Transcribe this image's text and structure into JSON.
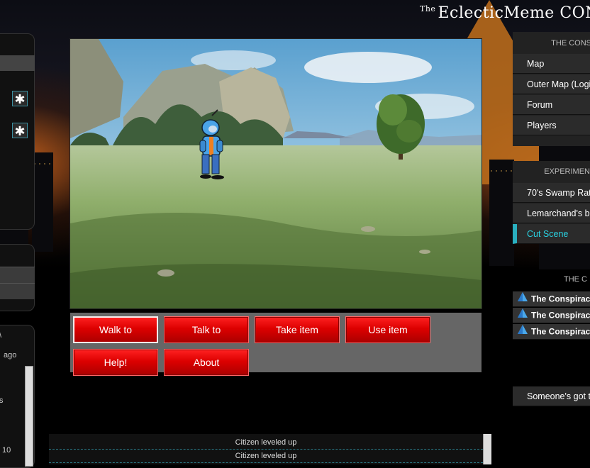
{
  "header": {
    "brand_the": "The",
    "brand_name": "EclecticMeme CON"
  },
  "left_panel": {
    "star_glyph": "✱",
    "log_fragment_1": "\\",
    "log_fragment_2": "ago",
    "log_fragment_3": "s",
    "log_fragment_4": "10"
  },
  "verbs": {
    "walk_to": "Walk to",
    "talk_to": "Talk to",
    "take_item": "Take item",
    "use_item": "Use item",
    "help": "Help!",
    "about": "About",
    "active_verb": "walk_to"
  },
  "log": {
    "lines": [
      "Citizen leveled up",
      "Citizen leveled up"
    ]
  },
  "sidebar": {
    "section1_title": "THE CONS",
    "section1_items": [
      "Map",
      "Outer Map (Logi",
      "Forum",
      "Players"
    ],
    "section2_title": "EXPERIMEN",
    "section2_items": [
      "70's Swamp Rat",
      "Lemarchand's b",
      "Cut Scene"
    ],
    "section2_selected": "Cut Scene",
    "section3_title": "THE C",
    "section3_items": [
      "The Conspirac",
      "The Conspirac",
      "The Conspirac"
    ],
    "footer_item": "Someone's got to"
  },
  "colors": {
    "accent_red": "#dd0000",
    "accent_cyan": "#2ad0e0",
    "sky_orange": "#c8601a"
  },
  "icons": [
    "star-icon",
    "pyramid-icon"
  ]
}
